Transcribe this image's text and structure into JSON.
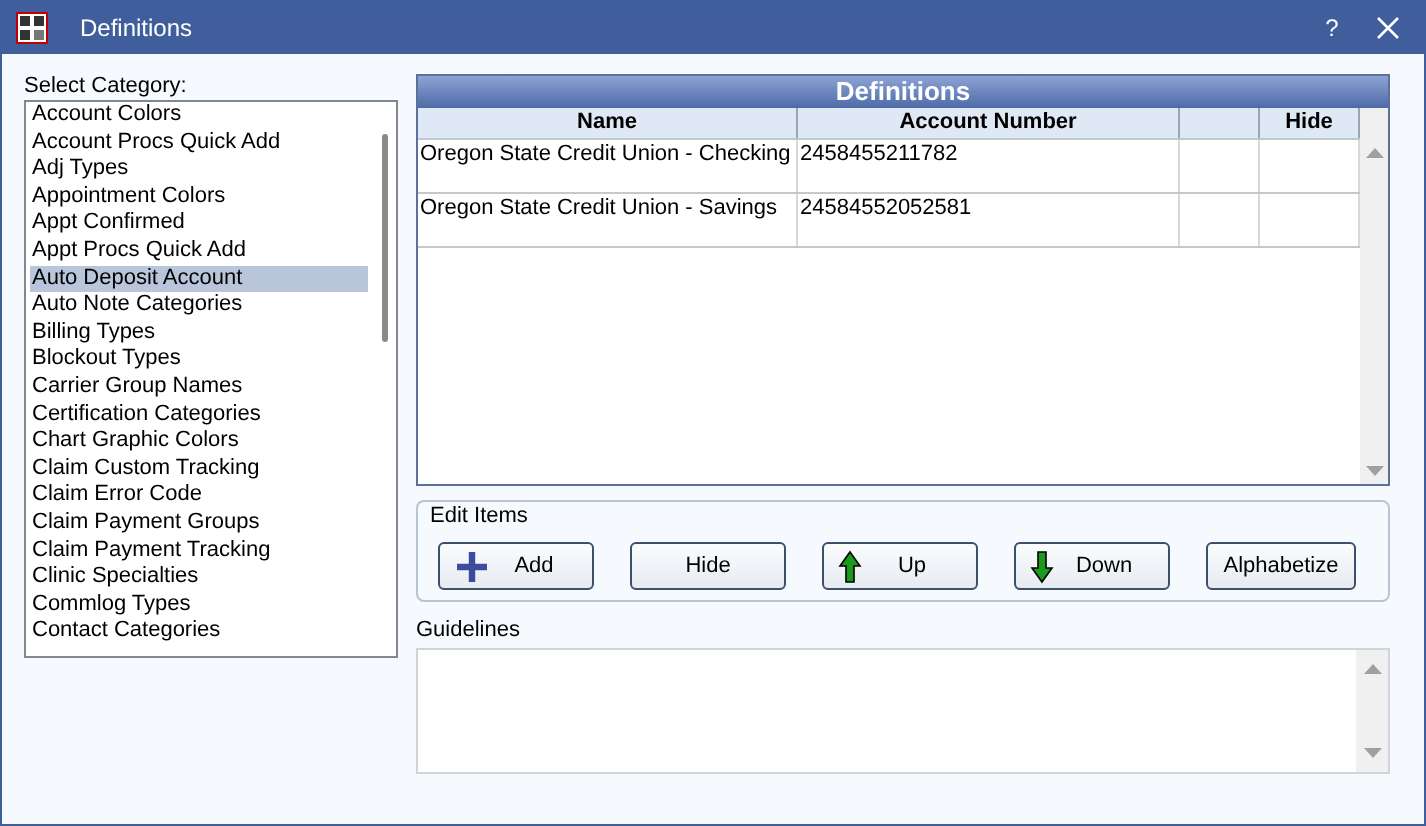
{
  "window": {
    "title": "Definitions",
    "help": "?"
  },
  "category_label": "Select Category:",
  "categories": [
    {
      "label": "Account Colors",
      "selected": false
    },
    {
      "label": "Account Procs Quick Add",
      "selected": false
    },
    {
      "label": "Adj Types",
      "selected": false
    },
    {
      "label": "Appointment Colors",
      "selected": false
    },
    {
      "label": "Appt Confirmed",
      "selected": false
    },
    {
      "label": "Appt Procs Quick Add",
      "selected": false
    },
    {
      "label": "Auto Deposit Account",
      "selected": true
    },
    {
      "label": "Auto Note Categories",
      "selected": false
    },
    {
      "label": "Billing Types",
      "selected": false
    },
    {
      "label": "Blockout Types",
      "selected": false
    },
    {
      "label": "Carrier Group Names",
      "selected": false
    },
    {
      "label": "Certification Categories",
      "selected": false
    },
    {
      "label": "Chart Graphic Colors",
      "selected": false
    },
    {
      "label": "Claim Custom Tracking",
      "selected": false
    },
    {
      "label": "Claim Error Code",
      "selected": false
    },
    {
      "label": "Claim Payment Groups",
      "selected": false
    },
    {
      "label": "Claim Payment Tracking",
      "selected": false
    },
    {
      "label": "Clinic Specialties",
      "selected": false
    },
    {
      "label": "Commlog Types",
      "selected": false
    },
    {
      "label": "Contact Categories",
      "selected": false
    }
  ],
  "grid": {
    "title": "Definitions",
    "columns": [
      "Name",
      "Account Number",
      "",
      "Hide"
    ],
    "rows": [
      [
        "Oregon State Credit Union - Checking",
        "2458455211782",
        "",
        ""
      ],
      [
        "Oregon State Credit Union - Savings",
        "24584552052581",
        "",
        ""
      ]
    ]
  },
  "edit_items": {
    "label": "Edit Items",
    "buttons": [
      {
        "kind": "add",
        "label": "Add"
      },
      {
        "kind": "plain",
        "label": "Hide"
      },
      {
        "kind": "up",
        "label": "Up"
      },
      {
        "kind": "down",
        "label": "Down"
      },
      {
        "kind": "plain",
        "label": "Alphabetize"
      }
    ]
  },
  "guidelines": {
    "label": "Guidelines"
  }
}
